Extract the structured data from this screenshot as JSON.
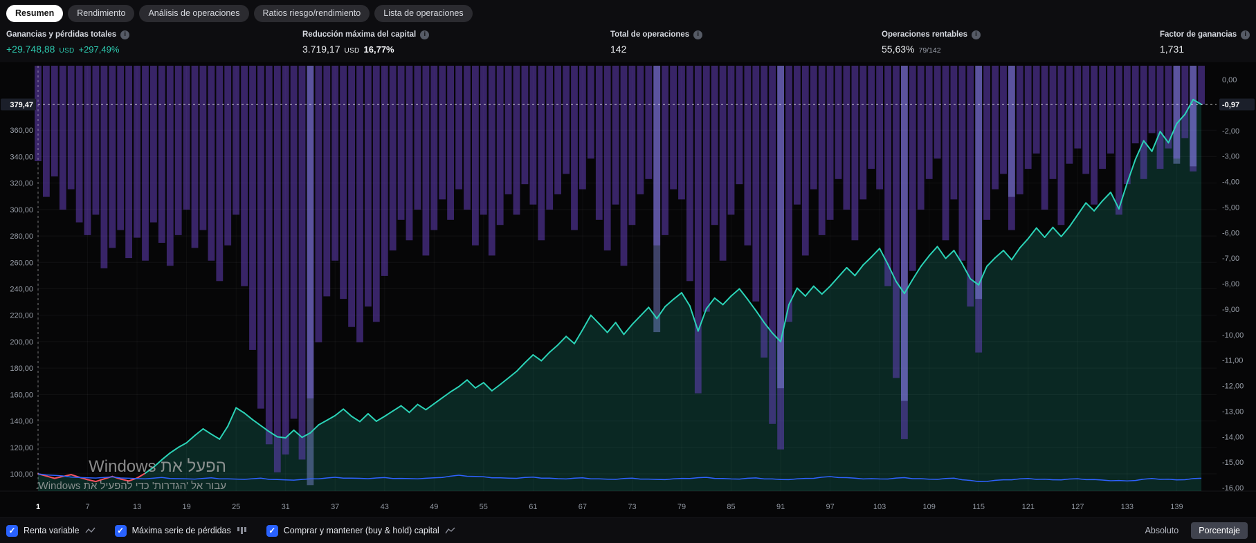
{
  "tabs": [
    {
      "label": "Resumen",
      "active": true
    },
    {
      "label": "Rendimiento",
      "active": false
    },
    {
      "label": "Análisis de operaciones",
      "active": false
    },
    {
      "label": "Ratios riesgo/rendimiento",
      "active": false
    },
    {
      "label": "Lista de operaciones",
      "active": false
    }
  ],
  "stats": [
    {
      "label": "Ganancias y pérdidas totales",
      "value": "+29.748,88",
      "unit": "USD",
      "extra": "+297,49%"
    },
    {
      "label": "Reducción máxima del capital",
      "value": "3.719,17",
      "unit": "USD",
      "extra": "16,77%"
    },
    {
      "label": "Total de operaciones",
      "value": "142"
    },
    {
      "label": "Operaciones rentables",
      "value": "55,63%",
      "extra": "79/142"
    },
    {
      "label": "Factor de ganancias",
      "value": "1,731"
    }
  ],
  "legend": [
    {
      "label": "Renta variable",
      "checked": true,
      "icon": "equity-curve-icon"
    },
    {
      "label": "Máxima serie de pérdidas",
      "checked": true,
      "icon": "histogram-icon"
    },
    {
      "label": "Comprar y mantener (buy & hold) capital",
      "checked": true,
      "icon": "line-icon"
    }
  ],
  "footer": {
    "absolute": "Absoluto",
    "percent": "Porcentaje",
    "selected": "percent"
  },
  "watermark": {
    "line1": "הפעל את Windows",
    "line2": "עבור אל 'הגדרות' כדי להפעיל את Windows."
  },
  "colors": {
    "equity_line": "#2bd3b7",
    "equity_below_baseline": "#f7525f",
    "equity_area": "rgba(31,179,152,0.20)",
    "drawdown_bar": "rgba(106,66,199,0.50)",
    "highlight_bar": "rgba(140,150,235,0.42)",
    "buy_hold_line": "#2e62ff",
    "accent_positive": "#2dc6ac",
    "checkbox_blue": "#2962ff",
    "axis_text": "#9aa0aa",
    "badge_bg": "#1b1f2a"
  },
  "chart_data": {
    "type": "line+bar",
    "baseline": 100,
    "x_ticks": [
      1,
      7,
      13,
      19,
      25,
      31,
      37,
      43,
      49,
      55,
      61,
      67,
      73,
      79,
      85,
      91,
      97,
      103,
      109,
      115,
      121,
      127,
      133,
      139
    ],
    "left_axis": {
      "ticks": [
        360,
        340,
        320,
        300,
        280,
        260,
        240,
        220,
        200,
        180,
        160,
        140,
        120,
        100
      ],
      "last_value": 379.47,
      "last_label": "379,47"
    },
    "right_axis": {
      "ticks": [
        0,
        -2,
        -3,
        -4,
        -5,
        -6,
        -7,
        -8,
        -9,
        -10,
        -11,
        -12,
        -13,
        -14,
        -15,
        -16
      ],
      "last_value": -0.97,
      "last_label": "-0,97"
    },
    "series": [
      {
        "name": "Renta variable",
        "type": "area-line",
        "values": [
          100,
          98.3,
          96.6,
          98,
          99.4,
          97.4,
          95.6,
          94.2,
          96.2,
          98,
          96.1,
          94.6,
          96.8,
          100.5,
          105,
          110.6,
          115.8,
          120,
          123.5,
          129,
          134,
          130,
          126.2,
          136,
          150,
          146,
          141,
          136.5,
          132,
          128,
          127.2,
          133,
          127.6,
          131,
          137,
          140.5,
          144,
          149,
          143.5,
          139.5,
          145.5,
          139.8,
          143.5,
          147.5,
          151.5,
          146.5,
          152.5,
          148.5,
          153,
          157.5,
          162,
          166,
          171,
          165,
          169,
          162.8,
          167.5,
          172.5,
          177.5,
          184,
          190,
          185.5,
          192,
          197.5,
          204,
          198.5,
          209,
          220,
          213.5,
          207,
          214.5,
          205.5,
          213,
          219.5,
          226,
          217.5,
          226.5,
          232,
          237,
          227,
          208,
          225,
          233,
          228,
          234.5,
          240,
          232,
          223.5,
          214.5,
          206.5,
          200,
          228,
          240.5,
          234.5,
          242,
          236,
          242,
          249,
          256,
          250,
          258,
          264,
          270.5,
          258.5,
          245.5,
          236.5,
          247,
          257,
          265,
          272,
          263,
          269,
          259,
          247.5,
          243,
          257,
          263.5,
          269,
          262,
          271,
          278,
          286,
          279,
          286.5,
          279.5,
          287,
          296,
          305,
          299,
          306.5,
          313,
          300.5,
          320,
          338,
          352,
          344,
          359,
          350.5,
          365,
          372,
          383.2,
          379.47
        ]
      },
      {
        "name": "Máxima serie de pérdidas",
        "type": "bar",
        "values": [
          -3.2,
          -4.6,
          -3.8,
          -5.1,
          -4.3,
          -5.6,
          -6.1,
          -5.3,
          -7.4,
          -6.6,
          -5.9,
          -7,
          -6.2,
          -7.1,
          -5.6,
          -6.4,
          -7.3,
          -6.1,
          -5.1,
          -6.6,
          -5.9,
          -7.1,
          -7.9,
          -6.5,
          -5.3,
          -8.1,
          -10.6,
          -12.9,
          -14.3,
          -15.4,
          -14.7,
          -13.3,
          -14.9,
          -12.5,
          -10.3,
          -8.5,
          -7.1,
          -8.6,
          -9.7,
          -10.3,
          -8.9,
          -9.5,
          -7.7,
          -6.7,
          -5.5,
          -6.3,
          -5.1,
          -6.9,
          -5.9,
          -4.7,
          -5.5,
          -4.3,
          -5.1,
          -6.5,
          -5.3,
          -6.9,
          -5.7,
          -4.5,
          -5.3,
          -4.1,
          -4.9,
          -6.3,
          -5.1,
          -4.5,
          -3.7,
          -5.9,
          -4.3,
          -3.1,
          -5.5,
          -6.7,
          -4.9,
          -7.3,
          -5.7,
          -4.5,
          -3.9,
          -6.5,
          -6.1,
          -4.3,
          -4.7,
          -7.9,
          -12.3,
          -9.1,
          -5.7,
          -7.1,
          -5.3,
          -4.1,
          -6.5,
          -8.7,
          -10.9,
          -13.5,
          -14.5,
          -9.5,
          -4.9,
          -6.9,
          -4.3,
          -6.1,
          -5.5,
          -3.9,
          -5.1,
          -6.3,
          -4.7,
          -3.5,
          -4.3,
          -8.1,
          -11.7,
          -14.1,
          -7.5,
          -5.1,
          -3.9,
          -3.1,
          -6.3,
          -4.7,
          -7.1,
          -8.9,
          -10.7,
          -5.5,
          -4.3,
          -3.7,
          -5.9,
          -4.5,
          -3.5,
          -2.9,
          -5.1,
          -3.9,
          -5.7,
          -3.3,
          -2.7,
          -3.7,
          -4.9,
          -3.5,
          -2.9,
          -5.3,
          -4.1,
          -2.5,
          -3.9,
          -2.1,
          -3.5,
          -2.7,
          -3.1,
          -2.3,
          -3.6,
          -0.97
        ]
      },
      {
        "name": "Comprar y mantener (buy & hold) capital",
        "type": "line",
        "anchors": [
          [
            1,
            100
          ],
          [
            4,
            98.2
          ],
          [
            7,
            96.8
          ],
          [
            10,
            97.5
          ],
          [
            13,
            96.2
          ],
          [
            16,
            97
          ],
          [
            19,
            96
          ],
          [
            22,
            96.8
          ],
          [
            25,
            95.8
          ],
          [
            28,
            96.5
          ],
          [
            31,
            95.2
          ],
          [
            34,
            96
          ],
          [
            37,
            97.2
          ],
          [
            40,
            96.4
          ],
          [
            43,
            97
          ],
          [
            46,
            96.2
          ],
          [
            49,
            96.8
          ],
          [
            52,
            98.8
          ],
          [
            55,
            97.6
          ],
          [
            58,
            96.6
          ],
          [
            61,
            97.4
          ],
          [
            64,
            96.2
          ],
          [
            67,
            96.8
          ],
          [
            70,
            95.8
          ],
          [
            73,
            96.6
          ],
          [
            76,
            95.6
          ],
          [
            79,
            96.4
          ],
          [
            82,
            97.2
          ],
          [
            85,
            96
          ],
          [
            88,
            96.8
          ],
          [
            91,
            95.6
          ],
          [
            94,
            96.4
          ],
          [
            97,
            97.8
          ],
          [
            100,
            96.6
          ],
          [
            103,
            96
          ],
          [
            106,
            97
          ],
          [
            109,
            95.8
          ],
          [
            112,
            96.6
          ],
          [
            115,
            94
          ],
          [
            118,
            95.4
          ],
          [
            121,
            96.4
          ],
          [
            124,
            95.4
          ],
          [
            127,
            96.2
          ],
          [
            130,
            95.2
          ],
          [
            133,
            94.6
          ],
          [
            136,
            96.4
          ],
          [
            139,
            95.4
          ],
          [
            142,
            96.6
          ]
        ]
      }
    ],
    "highlight_bars": [
      {
        "i": 34,
        "v": -15.9
      },
      {
        "i": 76,
        "v": -9.9
      },
      {
        "i": 91,
        "v": -12.1
      },
      {
        "i": 106,
        "v": -12.6
      },
      {
        "i": 115,
        "v": -8.6
      },
      {
        "i": 119,
        "v": -4.6
      },
      {
        "i": 139,
        "v": -3.3
      },
      {
        "i": 141,
        "v": -3.4
      }
    ]
  }
}
